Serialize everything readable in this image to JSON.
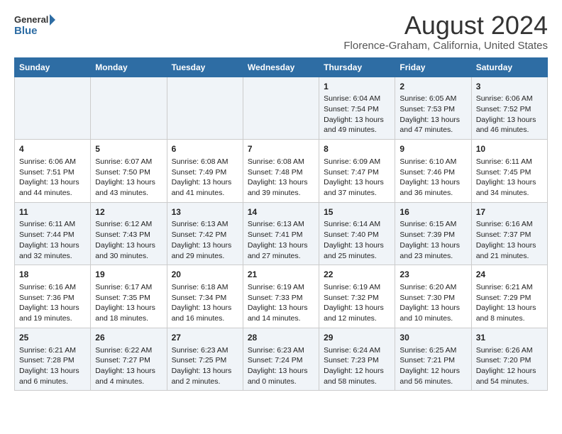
{
  "header": {
    "logo_line1": "General",
    "logo_line2": "Blue",
    "month": "August 2024",
    "location": "Florence-Graham, California, United States"
  },
  "days_of_week": [
    "Sunday",
    "Monday",
    "Tuesday",
    "Wednesday",
    "Thursday",
    "Friday",
    "Saturday"
  ],
  "weeks": [
    [
      {
        "day": "",
        "content": ""
      },
      {
        "day": "",
        "content": ""
      },
      {
        "day": "",
        "content": ""
      },
      {
        "day": "",
        "content": ""
      },
      {
        "day": "1",
        "content": "Sunrise: 6:04 AM\nSunset: 7:54 PM\nDaylight: 13 hours\nand 49 minutes."
      },
      {
        "day": "2",
        "content": "Sunrise: 6:05 AM\nSunset: 7:53 PM\nDaylight: 13 hours\nand 47 minutes."
      },
      {
        "day": "3",
        "content": "Sunrise: 6:06 AM\nSunset: 7:52 PM\nDaylight: 13 hours\nand 46 minutes."
      }
    ],
    [
      {
        "day": "4",
        "content": "Sunrise: 6:06 AM\nSunset: 7:51 PM\nDaylight: 13 hours\nand 44 minutes."
      },
      {
        "day": "5",
        "content": "Sunrise: 6:07 AM\nSunset: 7:50 PM\nDaylight: 13 hours\nand 43 minutes."
      },
      {
        "day": "6",
        "content": "Sunrise: 6:08 AM\nSunset: 7:49 PM\nDaylight: 13 hours\nand 41 minutes."
      },
      {
        "day": "7",
        "content": "Sunrise: 6:08 AM\nSunset: 7:48 PM\nDaylight: 13 hours\nand 39 minutes."
      },
      {
        "day": "8",
        "content": "Sunrise: 6:09 AM\nSunset: 7:47 PM\nDaylight: 13 hours\nand 37 minutes."
      },
      {
        "day": "9",
        "content": "Sunrise: 6:10 AM\nSunset: 7:46 PM\nDaylight: 13 hours\nand 36 minutes."
      },
      {
        "day": "10",
        "content": "Sunrise: 6:11 AM\nSunset: 7:45 PM\nDaylight: 13 hours\nand 34 minutes."
      }
    ],
    [
      {
        "day": "11",
        "content": "Sunrise: 6:11 AM\nSunset: 7:44 PM\nDaylight: 13 hours\nand 32 minutes."
      },
      {
        "day": "12",
        "content": "Sunrise: 6:12 AM\nSunset: 7:43 PM\nDaylight: 13 hours\nand 30 minutes."
      },
      {
        "day": "13",
        "content": "Sunrise: 6:13 AM\nSunset: 7:42 PM\nDaylight: 13 hours\nand 29 minutes."
      },
      {
        "day": "14",
        "content": "Sunrise: 6:13 AM\nSunset: 7:41 PM\nDaylight: 13 hours\nand 27 minutes."
      },
      {
        "day": "15",
        "content": "Sunrise: 6:14 AM\nSunset: 7:40 PM\nDaylight: 13 hours\nand 25 minutes."
      },
      {
        "day": "16",
        "content": "Sunrise: 6:15 AM\nSunset: 7:39 PM\nDaylight: 13 hours\nand 23 minutes."
      },
      {
        "day": "17",
        "content": "Sunrise: 6:16 AM\nSunset: 7:37 PM\nDaylight: 13 hours\nand 21 minutes."
      }
    ],
    [
      {
        "day": "18",
        "content": "Sunrise: 6:16 AM\nSunset: 7:36 PM\nDaylight: 13 hours\nand 19 minutes."
      },
      {
        "day": "19",
        "content": "Sunrise: 6:17 AM\nSunset: 7:35 PM\nDaylight: 13 hours\nand 18 minutes."
      },
      {
        "day": "20",
        "content": "Sunrise: 6:18 AM\nSunset: 7:34 PM\nDaylight: 13 hours\nand 16 minutes."
      },
      {
        "day": "21",
        "content": "Sunrise: 6:19 AM\nSunset: 7:33 PM\nDaylight: 13 hours\nand 14 minutes."
      },
      {
        "day": "22",
        "content": "Sunrise: 6:19 AM\nSunset: 7:32 PM\nDaylight: 13 hours\nand 12 minutes."
      },
      {
        "day": "23",
        "content": "Sunrise: 6:20 AM\nSunset: 7:30 PM\nDaylight: 13 hours\nand 10 minutes."
      },
      {
        "day": "24",
        "content": "Sunrise: 6:21 AM\nSunset: 7:29 PM\nDaylight: 13 hours\nand 8 minutes."
      }
    ],
    [
      {
        "day": "25",
        "content": "Sunrise: 6:21 AM\nSunset: 7:28 PM\nDaylight: 13 hours\nand 6 minutes."
      },
      {
        "day": "26",
        "content": "Sunrise: 6:22 AM\nSunset: 7:27 PM\nDaylight: 13 hours\nand 4 minutes."
      },
      {
        "day": "27",
        "content": "Sunrise: 6:23 AM\nSunset: 7:25 PM\nDaylight: 13 hours\nand 2 minutes."
      },
      {
        "day": "28",
        "content": "Sunrise: 6:23 AM\nSunset: 7:24 PM\nDaylight: 13 hours\nand 0 minutes."
      },
      {
        "day": "29",
        "content": "Sunrise: 6:24 AM\nSunset: 7:23 PM\nDaylight: 12 hours\nand 58 minutes."
      },
      {
        "day": "30",
        "content": "Sunrise: 6:25 AM\nSunset: 7:21 PM\nDaylight: 12 hours\nand 56 minutes."
      },
      {
        "day": "31",
        "content": "Sunrise: 6:26 AM\nSunset: 7:20 PM\nDaylight: 12 hours\nand 54 minutes."
      }
    ]
  ]
}
